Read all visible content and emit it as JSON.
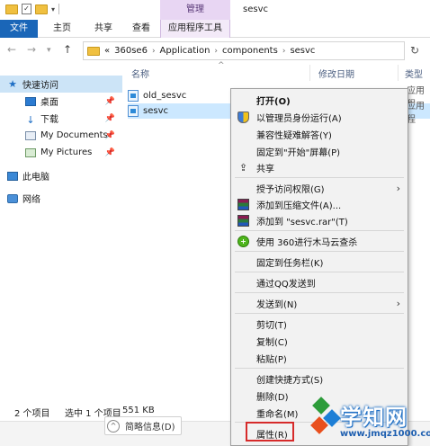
{
  "titlebar": {
    "tool_tab_header": "管理",
    "window_title": "sesvc"
  },
  "ribbon": {
    "tabs": [
      {
        "label": "文件"
      },
      {
        "label": "主页"
      },
      {
        "label": "共享"
      },
      {
        "label": "查看"
      },
      {
        "label": "应用程序工具"
      }
    ]
  },
  "address": {
    "overflow": "«",
    "segments": [
      "360se6",
      "Application",
      "components",
      "sesvc"
    ],
    "separator": "›",
    "back": "←",
    "forward": "→",
    "up": "↑",
    "refresh": "↻"
  },
  "navpane": {
    "items": [
      {
        "label": "快速访问",
        "icon": "star-icon"
      },
      {
        "label": "桌面",
        "icon": "desktop-icon",
        "pinned": true
      },
      {
        "label": "下载",
        "icon": "download-icon",
        "pinned": true
      },
      {
        "label": "My Documents",
        "icon": "documents-icon",
        "pinned": true
      },
      {
        "label": "My Pictures",
        "icon": "pictures-icon",
        "pinned": true
      },
      {
        "label": "此电脑",
        "icon": "computer-icon"
      },
      {
        "label": "网络",
        "icon": "network-icon"
      }
    ]
  },
  "filelist": {
    "columns": [
      "名称",
      "修改日期",
      "类型"
    ],
    "rows": [
      {
        "name": "old_sesvc",
        "type": "应用程"
      },
      {
        "name": "sesvc",
        "type": "应用程"
      }
    ]
  },
  "status": {
    "count": "2 个项目",
    "selected": "选中 1 个项目",
    "size": "551 KB",
    "details_button": "简略信息(D)"
  },
  "context_menu": {
    "items": [
      {
        "label": "打开(O)",
        "bold": true
      },
      {
        "label": "以管理员身份运行(A)",
        "icon": "shield-icon"
      },
      {
        "label": "兼容性疑难解答(Y)"
      },
      {
        "label": "固定到\"开始\"屏幕(P)"
      },
      {
        "label": "共享",
        "icon": "share-icon"
      },
      {
        "label": "授予访问权限(G)",
        "submenu": true
      },
      {
        "label": "添加到压缩文件(A)...",
        "icon": "winrar-icon"
      },
      {
        "label": "添加到 \"sesvc.rar\"(T)",
        "icon": "winrar-icon"
      },
      {
        "label": "使用 360进行木马云查杀",
        "icon": "360-icon"
      },
      {
        "label": "固定到任务栏(K)"
      },
      {
        "label": "通过QQ发送到"
      },
      {
        "label": "发送到(N)",
        "submenu": true
      },
      {
        "label": "剪切(T)"
      },
      {
        "label": "复制(C)"
      },
      {
        "label": "粘贴(P)"
      },
      {
        "label": "创建快捷方式(S)"
      },
      {
        "label": "删除(D)"
      },
      {
        "label": "重命名(M)"
      },
      {
        "label": "属性(R)"
      }
    ],
    "submenu_arrow": "›"
  },
  "watermark": {
    "title": "学知网",
    "url": "www.jmqz1000.com"
  }
}
